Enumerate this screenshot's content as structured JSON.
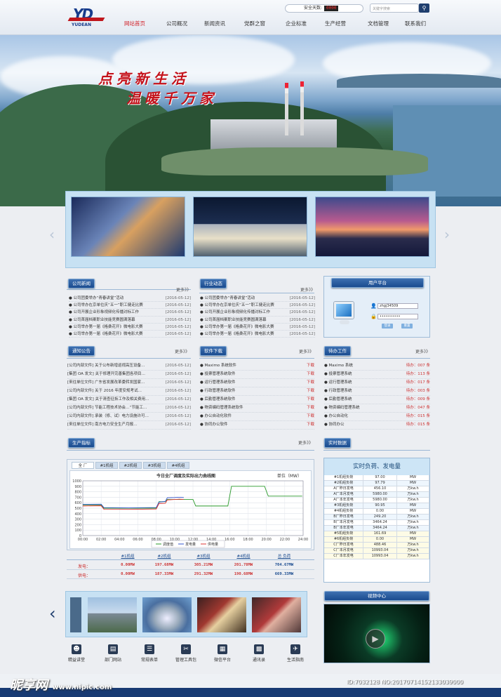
{
  "header": {
    "logo_mark": "YD",
    "logo_sub": "YUDEAN",
    "safety_label": "安全天数:",
    "safety_days": "0000",
    "search_placeholder": "关键字搜索",
    "nav": [
      "网站首页",
      "公司概况",
      "新闻资讯",
      "党群之窗",
      "企业标准",
      "生产经营",
      "文档管理",
      "联系我们"
    ],
    "active_nav": "网站首页"
  },
  "banner": {
    "slogan_line1": "点亮新生活",
    "slogan_line2": "温暖千万家"
  },
  "panels": {
    "company_news": {
      "title": "公司新闻",
      "more": "更多》》",
      "items": [
        {
          "text": "● 公司团委举办“青春讲堂”活动",
          "date": "[2016-05-12]"
        },
        {
          "text": "● 公司举办在京单位庆“五一”职工健走比赛",
          "date": "[2016-05-12]"
        },
        {
          "text": "● 公司开展企业形象视频化传播对标工作",
          "date": "[2016-05-12]"
        },
        {
          "text": "● 公司首届档案职业技能竞赛圆满落幕",
          "date": "[2016-05-12]"
        },
        {
          "text": "● 公司举办第一届《格桑花开》微电影大赛",
          "date": "[2016-05-12]"
        },
        {
          "text": "● 公司举办第一届《格桑花开》微电影大赛",
          "date": "[2016-05-12]"
        }
      ]
    },
    "industry_news": {
      "title": "行业动态",
      "more": "更多》》",
      "items": [
        {
          "text": "● 公司团委举办“青春讲堂”活动",
          "date": "[2016-05-12]"
        },
        {
          "text": "● 公司举办在京单位庆“五一”职工健走比赛",
          "date": "[2016-05-12]"
        },
        {
          "text": "● 公司开展企业形象视频化传播对标工作",
          "date": "[2016-05-12]"
        },
        {
          "text": "● 公司首届档案职业技能竞赛圆满落幕",
          "date": "[2016-05-12]"
        },
        {
          "text": "● 公司举办第一届《格桑花开》微电影大赛",
          "date": "[2016-05-12]"
        },
        {
          "text": "● 公司举办第一届《格桑花开》微电影大赛",
          "date": "[2016-05-12]"
        }
      ]
    },
    "user_platform": {
      "title": "用户平台",
      "username": "zhgj34509",
      "password": "••••••••••",
      "login": "登录",
      "reset": "重置"
    },
    "notices": {
      "title": "通知公告",
      "more": "更多》》",
      "items": [
        {
          "text": "[公司内部文件] 关于公布新增巡视高压设备…",
          "date": "[2016-05-12]"
        },
        {
          "text": "[集团 OA 发文] 关于修理开完善集团各项目…",
          "date": "[2016-05-12]"
        },
        {
          "text": "[来往单位文件] 广东省发展改革委转发国家…",
          "date": "[2016-05-12]"
        },
        {
          "text": "[公司内部文件] 关于 2016 年度安规考试…",
          "date": "[2016-05-12]"
        },
        {
          "text": "[集团 OA 发文] 关于清查征拆工作及相关费用…",
          "date": "[2016-05-12]"
        },
        {
          "text": "[公司内部文件] 节能工程技术协会…“节能工…",
          "date": "[2016-05-12]"
        },
        {
          "text": "[公司内部文件] 承装（修、试）电力设施许可…",
          "date": "[2016-05-12]"
        },
        {
          "text": "[来往单位文件] 南方电力安全生产月报…",
          "date": "[2016-05-12]"
        }
      ]
    },
    "software": {
      "title": "软件下载",
      "more": "更多》》",
      "download": "下载",
      "items": [
        "● Maximo 系统软件",
        "● 投票管理系统软件",
        "● 运行管理系统软件",
        "● 行政管理系统软件",
        "● 后勤管理系统软件",
        "● 物资编码管理系统软件",
        "● 办公自动化软件",
        "● 协同办公软件"
      ]
    },
    "todo": {
      "title": "待办工作",
      "more": "更多》》",
      "items": [
        {
          "text": "● Maximo 系统",
          "count": "待办：007 条"
        },
        {
          "text": "● 投票管理系统",
          "count": "待办：113 条"
        },
        {
          "text": "● 运行管理系统",
          "count": "待办：017 条"
        },
        {
          "text": "● 行政管理系统",
          "count": "待办：003 条"
        },
        {
          "text": "● 后勤管理系统",
          "count": "待办：009 条"
        },
        {
          "text": "● 物资编码管理系统",
          "count": "待办：047 条"
        },
        {
          "text": "● 办公自动化",
          "count": "待办：015 条"
        },
        {
          "text": "● 协同办公",
          "count": "待办：015 条"
        }
      ]
    },
    "production": {
      "title": "生产指标",
      "more": "更多》》",
      "tabs": [
        "全 厂",
        "#1机组",
        "#2机组",
        "#3机组",
        "#4机组"
      ],
      "stats_headers": [
        "#1机组",
        "#2机组",
        "#3机组",
        "#4机组",
        "总 负荷"
      ],
      "rows": [
        {
          "label": "发电：",
          "values": [
            "0.00MW",
            "197.68MW",
            "305.21MW",
            "201.78MW",
            "704.67MW"
          ]
        },
        {
          "label": "供电：",
          "values": [
            "0.00MW",
            "187.33MW",
            "291.32MW",
            "190.68MW",
            "669.33MW"
          ]
        }
      ]
    },
    "realtime": {
      "title": "实时数据",
      "heading": "实时负荷、发电量",
      "rows": [
        [
          "#1机组负荷",
          "97.00",
          "MW"
        ],
        [
          "#2机组负荷",
          "97.79",
          "MW"
        ],
        [
          "A厂昨日发电",
          "456.10",
          "万kw.h"
        ],
        [
          "A厂本月发电",
          "5980.00",
          "万kw.h"
        ],
        [
          "A厂本年发电",
          "5980.00",
          "万kw.h"
        ],
        [
          "#3机组负荷",
          "90.95",
          "MW"
        ],
        [
          "#4机组负荷",
          "0.00",
          "MW"
        ],
        [
          "B厂昨日发电",
          "249.20",
          "万kw.h"
        ],
        [
          "B厂本月发电",
          "3464.24",
          "万kw.h"
        ],
        [
          "B厂本年发电",
          "3464.24",
          "万kw.h"
        ],
        [
          "#5机组负荷",
          "161.69",
          "MW"
        ],
        [
          "#6机组负荷",
          "0.00",
          "MW"
        ],
        [
          "C厂昨日发电",
          "488.46",
          "万kw.h"
        ],
        [
          "C厂本月发电",
          "10993.04",
          "万kw.h"
        ],
        [
          "C厂本年发电",
          "10993.04",
          "万kw.h"
        ]
      ]
    },
    "video": {
      "title": "视频中心"
    }
  },
  "quick_links": [
    "精益讲堂",
    "部门网站",
    "常规表单",
    "管理工具包",
    "微信平台",
    "通讯录",
    "生活指南"
  ],
  "watermark": {
    "brand": "昵享网",
    "url": "www.nipic.com",
    "id": "ID:7032128 NO:20170714152133039000"
  },
  "chart_data": {
    "type": "line",
    "title": "今日全厂调度及实际出力曲线图",
    "unit": "单位（MW）",
    "x": [
      "00:00",
      "02:00",
      "04:00",
      "06:00",
      "08:00",
      "10:00",
      "12:00",
      "14:00",
      "16:00",
      "18:00",
      "20:00",
      "22:00",
      "24:00"
    ],
    "ylim": [
      0,
      1000
    ],
    "yticks": [
      0,
      100,
      200,
      300,
      400,
      500,
      600,
      700,
      800,
      900,
      1000
    ],
    "series": [
      {
        "name": "调度值",
        "color": "#2a9a2a",
        "points": [
          [
            0,
            560
          ],
          [
            2,
            560
          ],
          [
            2.3,
            500
          ],
          [
            8,
            500
          ],
          [
            8.3,
            620
          ],
          [
            9,
            620
          ],
          [
            9.2,
            660
          ],
          [
            12,
            660
          ],
          [
            12.3,
            540
          ],
          [
            15.8,
            540
          ],
          [
            16.2,
            900
          ],
          [
            19.8,
            900
          ],
          [
            20.2,
            720
          ],
          [
            23.9,
            720
          ]
        ]
      },
      {
        "name": "发电量",
        "color": "#3355cc",
        "points": [
          [
            0,
            570
          ],
          [
            2,
            572
          ],
          [
            2.3,
            510
          ],
          [
            5,
            505
          ],
          [
            8,
            512
          ],
          [
            8.3,
            610
          ],
          [
            9,
            625
          ],
          [
            9.2,
            690
          ],
          [
            10,
            695
          ],
          [
            10.5,
            700
          ],
          [
            11,
            695
          ]
        ]
      },
      {
        "name": "供电量",
        "color": "#d33",
        "points": [
          [
            0,
            540
          ],
          [
            2,
            545
          ],
          [
            2.3,
            480
          ],
          [
            5,
            478
          ],
          [
            8,
            485
          ],
          [
            8.3,
            585
          ],
          [
            9,
            590
          ],
          [
            9.2,
            650
          ],
          [
            10,
            660
          ],
          [
            10.5,
            665
          ],
          [
            11,
            660
          ]
        ]
      }
    ]
  },
  "colors": {
    "nav_active": "#d12027",
    "panel_tab": "#1a4b8f",
    "accent_red": "#c4121b"
  }
}
